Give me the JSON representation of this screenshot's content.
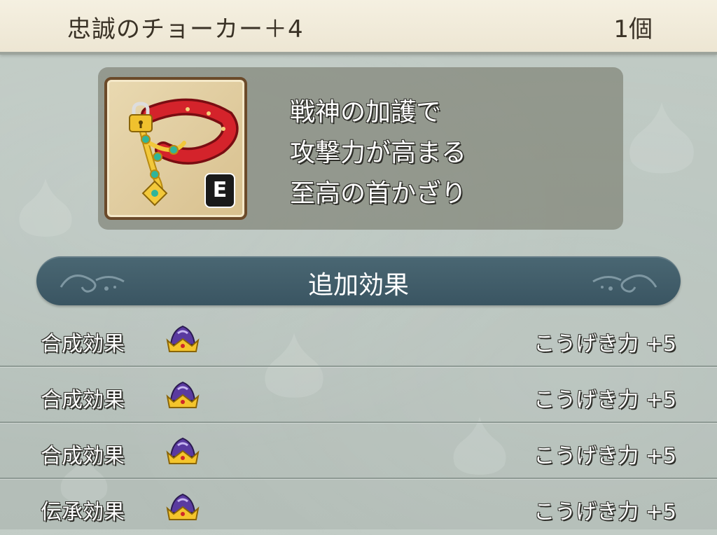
{
  "item": {
    "name": "忠誠のチョーカー＋4",
    "count": "1個",
    "icon": "red-choker-icon",
    "equipped_badge": "E",
    "locked_icon": "padlock-icon",
    "description": [
      "戦神の加護で",
      "攻撃力が高まる",
      "至高の首かざり"
    ]
  },
  "additional_effects": {
    "title": "追加効果",
    "rows": [
      {
        "label": "合成効果",
        "icon": "crown-icon",
        "effect": "こうげき力 +5"
      },
      {
        "label": "合成効果",
        "icon": "crown-icon",
        "effect": "こうげき力 +5"
      },
      {
        "label": "合成効果",
        "icon": "crown-icon",
        "effect": "こうげき力 +5"
      },
      {
        "label": "伝承効果",
        "icon": "crown-icon",
        "effect": "こうげき力 +5"
      }
    ]
  },
  "colors": {
    "header_bg": "#f2ecdc",
    "section_bar": "#43606c",
    "text_dark": "#3a3226"
  }
}
